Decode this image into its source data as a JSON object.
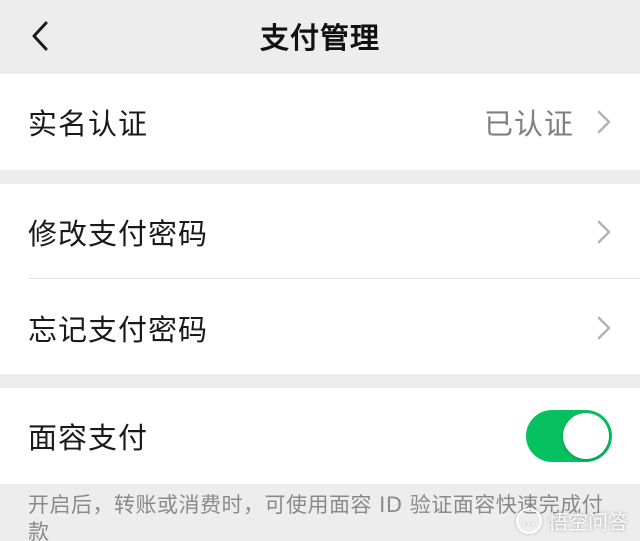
{
  "nav": {
    "title": "支付管理",
    "back_icon": "chevron-left-icon"
  },
  "section_identity": {
    "real_name": {
      "label": "实名认证",
      "value": "已认证",
      "icon": "chevron-right-icon"
    }
  },
  "section_password": {
    "change_password": {
      "label": "修改支付密码",
      "icon": "chevron-right-icon"
    },
    "forgot_password": {
      "label": "忘记支付密码",
      "icon": "chevron-right-icon"
    }
  },
  "section_face": {
    "face_pay": {
      "label": "面容支付",
      "toggle_on": true,
      "toggle_color": "#07c160"
    },
    "footnote": "开启后，转账或消费时，可使用面容 ID 验证面容快速完成付款"
  },
  "watermark": {
    "text": "悟空问答",
    "icon": "chat-bubble-icon"
  },
  "colors": {
    "background": "#ededed",
    "card": "#ffffff",
    "accent": "#07c160",
    "secondary_text": "#7f7f7f"
  }
}
